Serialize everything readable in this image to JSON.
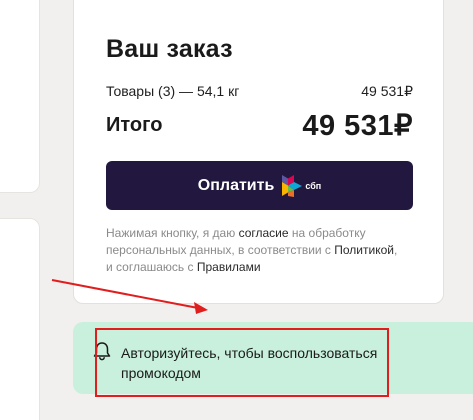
{
  "order": {
    "title": "Ваш заказ",
    "goods_label": "Товары (3) — 54,1 кг",
    "goods_price": "49 531₽",
    "total_label": "Итого",
    "total_value": "49 531₽"
  },
  "pay_button": {
    "label": "Оплатить",
    "logo_icon": "sbp-logo-icon",
    "logo_text": "сбп"
  },
  "consent": {
    "part1": "Нажимая кнопку, я даю ",
    "link_consent": "согласие",
    "part2": " на обработку персональных данных, в соответствии с ",
    "link_policy": "Политикой",
    "part3": ", и соглашаюсь с ",
    "link_rules": "Правилами"
  },
  "promo": {
    "icon": "bell-icon",
    "text": "Авторизуйтесь, чтобы воспользоваться промокодом"
  },
  "colors": {
    "page_bg": "#f1f0ee",
    "card_bg": "#ffffff",
    "pay_button_bg": "#22183f",
    "promo_bg": "#c8f0dc",
    "annotation_red": "#e01e1e"
  }
}
